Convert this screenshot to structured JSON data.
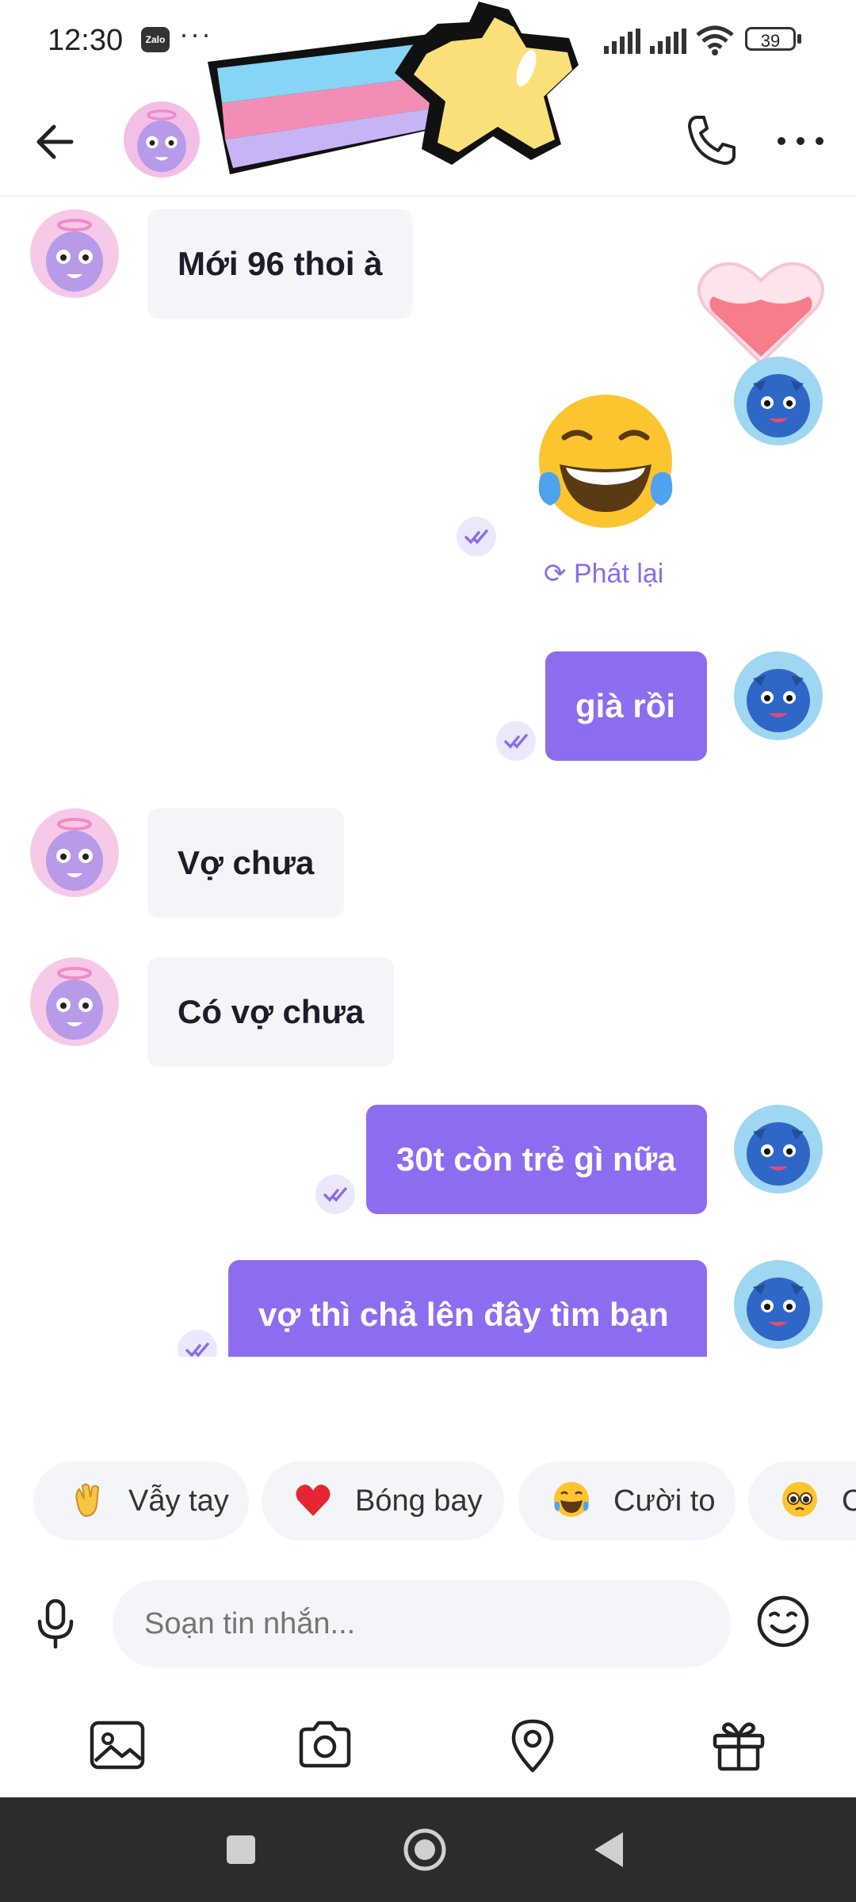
{
  "status": {
    "time": "12:30",
    "app_badge": "Zalo",
    "more": "···",
    "battery": "39"
  },
  "header": {
    "back_icon": "arrow-left-icon",
    "call_icon": "phone-icon",
    "more_icon": "more-horizontal-icon"
  },
  "messages": [
    {
      "side": "in",
      "text": "Mới 96 thoi à"
    },
    {
      "side": "out",
      "emoji": "laughing-tears-emoji",
      "replay_label": "Phát lại"
    },
    {
      "side": "out",
      "text": "già rồi"
    },
    {
      "side": "in",
      "text": "Vợ chưa"
    },
    {
      "side": "in",
      "text": "Có vợ chưa"
    },
    {
      "side": "out",
      "text": "30t còn trẻ gì nữa"
    },
    {
      "side": "out",
      "text": "vợ  thì chả lên đây tìm bạn"
    }
  ],
  "quick_reactions": [
    {
      "icon": "waving-hand-emoji",
      "label": "Vẫy tay"
    },
    {
      "icon": "red-heart-emoji",
      "label": "Bóng bay"
    },
    {
      "icon": "laughing-tears-emoji",
      "label": "Cười to"
    },
    {
      "icon": "pleading-face-emoji",
      "label": "C"
    }
  ],
  "composer": {
    "placeholder": "Soạn tin nhắn..."
  },
  "toolbar": [
    "image-icon",
    "camera-icon",
    "location-pin-icon",
    "gift-icon"
  ],
  "colors": {
    "accent": "#8e6cf0",
    "incoming_bubble": "#f4f5f8",
    "nav_bar": "#2c2c2c"
  }
}
